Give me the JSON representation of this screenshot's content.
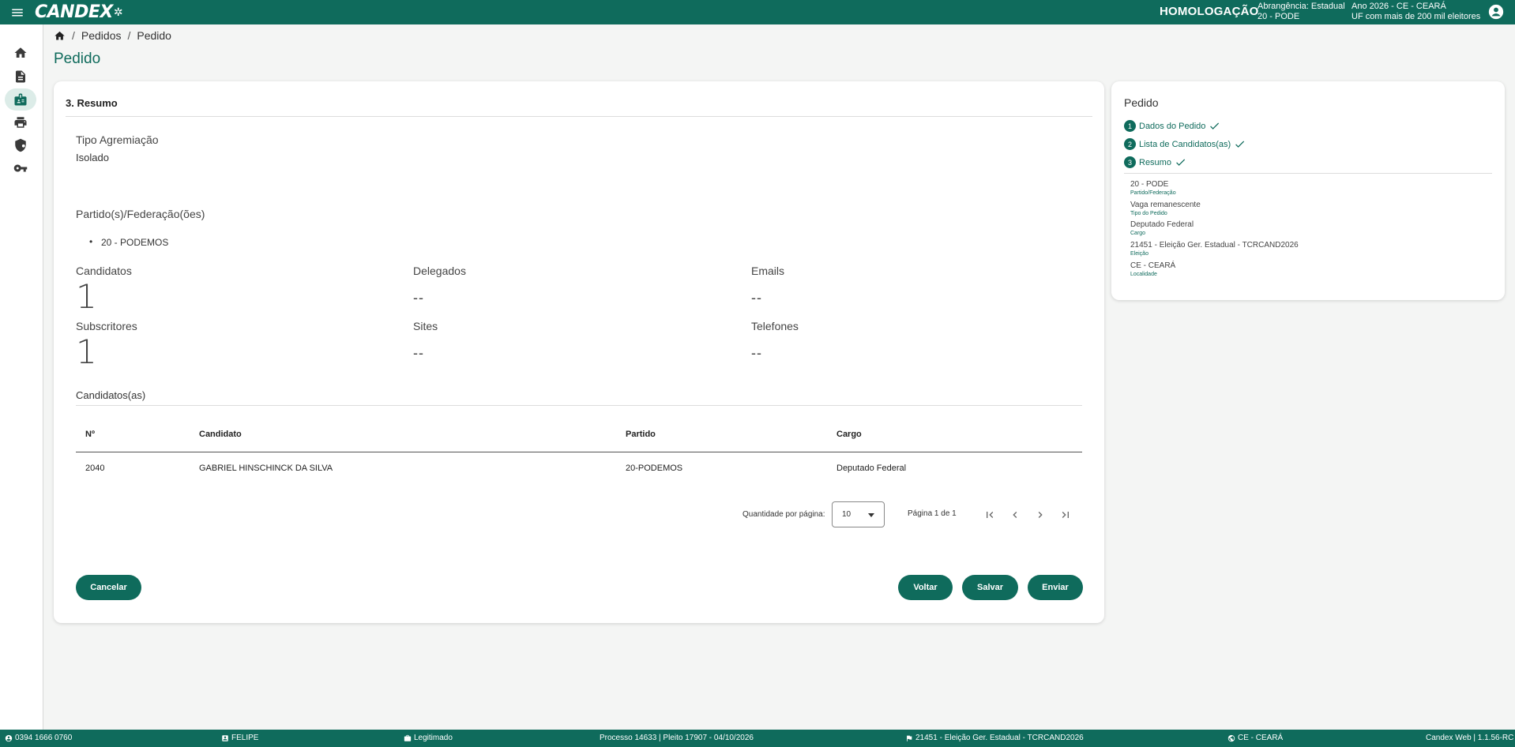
{
  "header": {
    "logo": "CANDEX",
    "environment": "HOMOLOGAÇÃO",
    "scope_line1": "Abrangência: Estadual",
    "scope_line2": "20 - PODE",
    "year_line1": "Ano 2026 - CE - CEARÁ",
    "year_line2": "UF com mais de 200 mil eleitores",
    "brand_color": "#0f6b5c"
  },
  "sidebar": {
    "items": [
      {
        "icon": "home-icon"
      },
      {
        "icon": "document-icon"
      },
      {
        "icon": "badge-icon",
        "active": true
      },
      {
        "icon": "print-icon"
      },
      {
        "icon": "shield-icon"
      },
      {
        "icon": "key-icon"
      }
    ]
  },
  "breadcrumb": {
    "items": [
      "Pedidos",
      "Pedido"
    ]
  },
  "page": {
    "title": "Pedido"
  },
  "summary": {
    "section_title": "3. Resumo",
    "tipo_label": "Tipo Agremiação",
    "tipo_value": "Isolado",
    "partidos_label": "Partido(s)/Federação(ões)",
    "partidos": [
      "20 - PODEMOS"
    ],
    "stats": {
      "candidatos_label": "Candidatos",
      "candidatos_value": "1",
      "delegados_label": "Delegados",
      "delegados_value": "--",
      "emails_label": "Emails",
      "emails_value": "--",
      "subscritores_label": "Subscritores",
      "subscritores_value": "1",
      "sites_label": "Sites",
      "sites_value": "--",
      "telefones_label": "Telefones",
      "telefones_value": "--"
    },
    "candidatos_title": "Candidatos(as)",
    "table": {
      "headers": [
        "Nº",
        "Candidato",
        "Partido",
        "Cargo"
      ],
      "rows": [
        [
          "2040",
          "GABRIEL HINSCHINCK DA SILVA",
          "20-PODEMOS",
          "Deputado Federal"
        ]
      ]
    },
    "pager": {
      "per_page_label": "Quantidade por página:",
      "per_page_value": "10",
      "page_info": "Página 1 de 1"
    },
    "buttons": {
      "cancel": "Cancelar",
      "back": "Voltar",
      "save": "Salvar",
      "send": "Enviar"
    }
  },
  "side": {
    "title": "Pedido",
    "steps": [
      {
        "num": "1",
        "label": "Dados do Pedido"
      },
      {
        "num": "2",
        "label": "Lista de Candidatos(as)"
      },
      {
        "num": "3",
        "label": "Resumo"
      }
    ],
    "info": [
      {
        "value": "20 - PODE",
        "key": "Partido/Federação"
      },
      {
        "value": "Vaga remanescente",
        "key": "Tipo do Pedido"
      },
      {
        "value": "Deputado Federal",
        "key": "Cargo"
      },
      {
        "value": "21451 - Eleição Ger. Estadual - TCRCAND2026",
        "key": "Eleição"
      },
      {
        "value": "CE - CEARÁ",
        "key": "Localidade"
      }
    ]
  },
  "footer": {
    "phone": "0394 1666 0760",
    "user": "FELIPE",
    "status": "Legitimado",
    "process": "Processo 14633 | Pleito 17907 - 04/10/2026",
    "election": "21451 - Eleição Ger. Estadual - TCRCAND2026",
    "location": "CE - CEARÁ",
    "version": "Candex Web | 1.1.56-RC"
  }
}
